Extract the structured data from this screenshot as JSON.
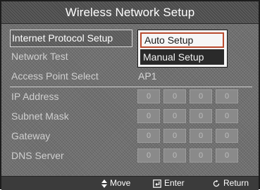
{
  "title": "Wireless Network Setup",
  "menu": {
    "items": [
      {
        "label": "Internet Protocol Setup"
      },
      {
        "label": "Network Test"
      },
      {
        "label": "Access Point Select"
      },
      {
        "label": "IP Address"
      },
      {
        "label": "Subnet Mask"
      },
      {
        "label": "Gateway"
      },
      {
        "label": "DNS Server"
      }
    ]
  },
  "dropdown": {
    "selected": "Auto Setup",
    "options": [
      "Auto Setup",
      "Manual Setup"
    ]
  },
  "access_point": {
    "value": "AP1"
  },
  "fields": {
    "ip_address": [
      "0",
      "0",
      "0",
      "0"
    ],
    "subnet_mask": [
      "0",
      "0",
      "0",
      "0"
    ],
    "gateway": [
      "0",
      "0",
      "0",
      "0"
    ],
    "dns_server": [
      "0",
      "0",
      "0",
      "0"
    ]
  },
  "footer": {
    "move_label": "Move",
    "enter_label": "Enter",
    "return_label": "Return"
  }
}
